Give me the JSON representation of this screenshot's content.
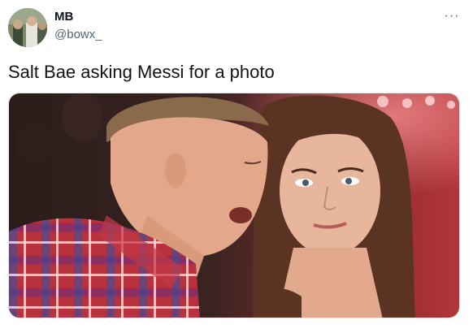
{
  "author": {
    "display_name": "MB",
    "handle": "@bowx_",
    "avatar_icon": "profile-photo-avatar"
  },
  "tweet": {
    "text": "Salt Bae asking Messi for a photo"
  },
  "more_icon": "more-dots-icon",
  "colors": {
    "text_primary": "#0f1419",
    "text_secondary": "#536471"
  }
}
